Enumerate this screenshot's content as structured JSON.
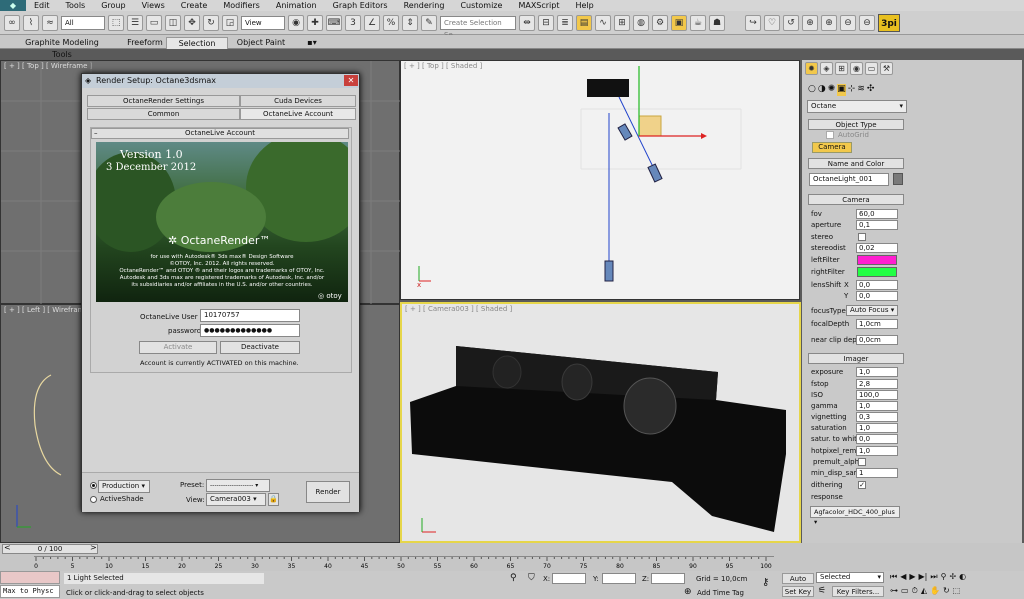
{
  "menu": [
    "Edit",
    "Tools",
    "Group",
    "Views",
    "Create",
    "Modifiers",
    "Animation",
    "Graph Editors",
    "Rendering",
    "Customize",
    "MAXScript",
    "Help"
  ],
  "toolbar": {
    "filter": "All",
    "coord": "View",
    "selection_set": "Create Selection Se",
    "logo": "3pi"
  },
  "ribbon": {
    "tabs": [
      "Graphite Modeling Tools",
      "Freeform",
      "Selection",
      "Object Paint"
    ],
    "selected": "Selection"
  },
  "viewports": {
    "top_left": "[ + ] [ Top ] [ Wireframe ]",
    "top_right": "[ + ] [ Top ] [ Shaded ]",
    "bottom_left": "[ + ] [ Left ] [ Wireframe ]",
    "bottom_right": "[ + ] [ Camera003 ] [ Shaded ]"
  },
  "dialog": {
    "title": "Render Setup: Octane3dsmax",
    "tabs_row1": [
      "OctaneRender Settings",
      "Cuda Devices"
    ],
    "tabs_row2": [
      "Common",
      "OctaneLive Account"
    ],
    "section": "OctaneLive Account",
    "version": "Version 1.0",
    "date": "3 December 2012",
    "brand": "OctaneRender™",
    "credits": [
      "for use with Autodesk® 3ds max® Design Software",
      "©OTOY, Inc. 2012. All rights reserved.",
      "OctaneRender™ and OTOY ® and their logos are trademarks of OTOY, Inc.",
      "Autodesk and 3ds max are registered trademarks of Autodesk, Inc. and/or",
      "its subsidiaries and/or affiliates in the U.S. and/or other countries."
    ],
    "otoy": "otoy",
    "user_label": "OctaneLive User id",
    "user_value": "10170757",
    "pass_label": "password",
    "pass_value": "●●●●●●●●●●●●●",
    "activate": "Activate",
    "deactivate": "Deactivate",
    "status": "Account is currently ACTIVATED on this machine.",
    "production": "Production",
    "activeshade": "ActiveShade",
    "preset_label": "Preset:",
    "preset_value": "--------------------",
    "view_label": "View:",
    "view_value": "Camera003",
    "render": "Render"
  },
  "cmd": {
    "category": "Octane",
    "object_type": "Object Type",
    "autogrid": "AutoGrid",
    "camera_btn": "Camera",
    "name_color": "Name and Color",
    "object_name": "OctaneLight_001",
    "camera_roll": "Camera",
    "fov_label": "fov",
    "fov": "60,0",
    "aperture_label": "aperture",
    "aperture": "0,1",
    "stereo_label": "stereo",
    "stereodist_label": "stereodist",
    "stereodist": "0,02",
    "leftfilter_label": "leftFilter",
    "rightfilter_label": "rightFilter",
    "lensshift_label": "lensShift",
    "x_label": "X",
    "y_label": "Y",
    "lensshift_x": "0,0",
    "lensshift_y": "0,0",
    "focustype_label": "focusType",
    "focustype": "Auto Focus",
    "focaldepth_label": "focalDepth",
    "focaldepth": "1,0cm",
    "nearclip_label": "near clip depth",
    "nearclip": "0,0cm",
    "imager": "Imager",
    "exposure_label": "exposure",
    "exposure": "1,0",
    "fstop_label": "fstop",
    "fstop": "2,8",
    "iso_label": "ISO",
    "iso": "100,0",
    "gamma_label": "gamma",
    "gamma": "1,0",
    "vignetting_label": "vignetting",
    "vignetting": "0,3",
    "saturation_label": "saturation",
    "saturation": "1,0",
    "satwhite_label": "satur. to white",
    "satwhite": "0,0",
    "hotpixel_label": "hotpixel_remov",
    "hotpixel": "1,0",
    "premult_label": "premult_alpha",
    "mindisp_label": "min_disp_samp.",
    "mindisp": "1",
    "dithering_label": "dithering",
    "response_label": "response",
    "response": "Agfacolor_HDC_400_plus",
    "colors": {
      "left": "#ff1fd0",
      "right": "#22ff44"
    }
  },
  "timeline": {
    "frame": "0 / 100",
    "ticks": [
      "0",
      "5",
      "10",
      "15",
      "20",
      "25",
      "30",
      "35",
      "40",
      "45",
      "50",
      "55",
      "60",
      "65",
      "70",
      "75",
      "80",
      "85",
      "90",
      "95",
      "100"
    ]
  },
  "status": {
    "script": "Max to Physc",
    "selected": "1 Light Selected",
    "hint": "Click or click-and-drag to select objects",
    "x_label": "X:",
    "y_label": "Y:",
    "z_label": "Z:",
    "grid": "Grid = 10,0cm",
    "addtime": "Add Time Tag",
    "autokey": "Auto Key",
    "setkey": "Set Key",
    "selected_dd": "Selected",
    "keyfilters": "Key Filters..."
  }
}
